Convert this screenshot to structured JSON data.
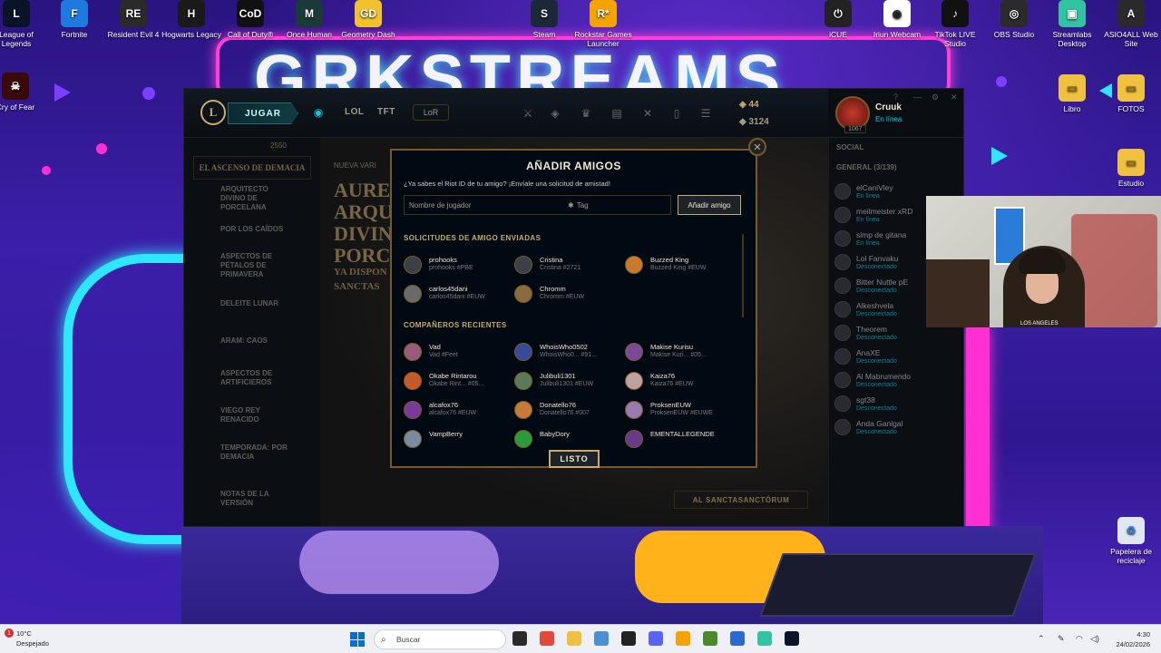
{
  "desktop": {
    "top_icons": [
      {
        "label": "League of Legends",
        "color": "#0a1428",
        "glyph": "L"
      },
      {
        "label": "Fortnite",
        "color": "#1f7ae0",
        "glyph": "F"
      },
      {
        "label": "Resident Evil 4",
        "color": "#2a2a2a",
        "glyph": "RE"
      },
      {
        "label": "Hogwarts Legacy",
        "color": "#1a1a1a",
        "glyph": "H"
      },
      {
        "label": "Call of Duty®",
        "color": "#111111",
        "glyph": "CoD"
      },
      {
        "label": "Once Human",
        "color": "#1a3a3a",
        "glyph": "M"
      },
      {
        "label": "Geometry Dash",
        "color": "#f2c12e",
        "glyph": "GD"
      },
      {
        "label": "Steam",
        "color": "#1b2838",
        "glyph": "S"
      },
      {
        "label": "Rockstar Games Launcher",
        "color": "#f4a300",
        "glyph": "R*"
      },
      {
        "label": "iCUE",
        "color": "#222222",
        "glyph": "⏻"
      },
      {
        "label": "Iriun Webcam",
        "color": "#ffffff",
        "glyph": "◉"
      },
      {
        "label": "TikTok LIVE Studio",
        "color": "#111111",
        "glyph": "♪"
      },
      {
        "label": "OBS Studio",
        "color": "#2b2b2b",
        "glyph": "◎"
      },
      {
        "label": "Streamlabs Desktop",
        "color": "#31c3a2",
        "glyph": "▣"
      },
      {
        "label": "ASIO4ALL Web Site",
        "color": "#2a2a2a",
        "glyph": "A"
      }
    ],
    "left_icon": {
      "label": "Cry of Fear",
      "color": "#3a0a0a",
      "glyph": "☠"
    },
    "right_icons": [
      {
        "label": "Libro",
        "color": "#f0c040",
        "glyph": "▭"
      },
      {
        "label": "FOTOS",
        "color": "#f0c040",
        "glyph": "▭"
      },
      {
        "label": "Estudio",
        "color": "#f0c040",
        "glyph": "▭"
      },
      {
        "label": "Papelera de reciclaje",
        "color": "#dfe8f0",
        "glyph": "♻"
      }
    ],
    "banner": "GRKSTREAMS"
  },
  "client": {
    "logo": "L",
    "play_label": "JUGAR",
    "nav": {
      "lol": "LOL",
      "tft": "TFT",
      "lor": "LoR"
    },
    "currency": {
      "blue_essence": "44",
      "rp": "3124"
    },
    "profile": {
      "name": "Cruuk",
      "status": "En línea",
      "level": "1067"
    },
    "left_panel": {
      "event_points": "2550",
      "event_title": "EL ASCENSO DE DEMACIA",
      "items": [
        "ARQUITECTO DIVINO DE PORCELANA",
        "POR LOS CAÍDOS",
        "ASPECTOS DE PÉTALOS DE PRIMAVERA",
        "DELEITE LUNAR",
        "ARAM: CAOS",
        "ASPECTOS DE ARTIFICIEROS",
        "VIEGO REY RENACIDO",
        "TEMPORADA: POR DEMACIA",
        "NOTAS DE LA VERSIÓN"
      ]
    },
    "main": {
      "kicker": "NUEVA VARI",
      "title_lines": [
        "AUREI",
        "ARQU",
        "DIVIN",
        "PORCEL"
      ],
      "subtitle_lines": [
        "YA DISPON",
        "SANCTAS"
      ],
      "cta": "AL SANCTASANCTÓRUM"
    },
    "social": {
      "header": "SOCIAL",
      "group": "GENERAL (3/139)",
      "friends": [
        {
          "name": "elCaniVley",
          "status": "En línea"
        },
        {
          "name": "meilmeister xRD",
          "status": "En línea"
        },
        {
          "name": "simp de gitana",
          "status": "En línea"
        },
        {
          "name": "Lol Fanvaku",
          "status": "Desconectado"
        },
        {
          "name": "Bitter Nuttle pE",
          "status": "Desconectado"
        },
        {
          "name": "Alkeshvela",
          "status": "Desconectado"
        },
        {
          "name": "Theorem",
          "status": "Desconectado"
        },
        {
          "name": "AnaXE",
          "status": "Desconectado"
        },
        {
          "name": "Al Mabrumendo",
          "status": "Desconectado"
        },
        {
          "name": "sgt38",
          "status": "Desconectado"
        },
        {
          "name": "Anda Ganlgal",
          "status": "Desconectado"
        }
      ]
    }
  },
  "modal": {
    "title": "AÑADIR AMIGOS",
    "subtitle": "¿Ya sabes el Riot ID de tu amigo? ¡Envíale una solicitud de amistad!",
    "input_placeholder": "Nombre de jugador",
    "tag_placeholder": "Tag",
    "add_button": "Añadir amigo",
    "sent_section": "SOLICITUDES DE AMIGO ENVIADAS",
    "sent": [
      {
        "name": "prohooks",
        "tag": "prohooks #PBE",
        "color": "#3a3f48"
      },
      {
        "name": "Cristina",
        "tag": "Cristina #2721",
        "color": "#3a3f48"
      },
      {
        "name": "Buzzed King",
        "tag": "Buzzed King #EUW",
        "color": "#c87a2a"
      },
      {
        "name": "carlos45dani",
        "tag": "carlos45dani #EUW",
        "color": "#6a6a6a"
      },
      {
        "name": "Chromm",
        "tag": "Chromm #EUW",
        "color": "#8a6a40"
      }
    ],
    "recent_section": "COMPAÑEROS RECIENTES",
    "recent": [
      {
        "name": "Vad",
        "tag": "Vad #Feet",
        "color": "#9a5a7a"
      },
      {
        "name": "WhoisWho0502",
        "tag": "WhoisWho0... #91...",
        "color": "#3a4a9a"
      },
      {
        "name": "Makise Kurisu",
        "tag": "Makise Kuri... #05...",
        "color": "#7a4a9a"
      },
      {
        "name": "Okabe Rintarou",
        "tag": "Okabe Rint... #05...",
        "color": "#c85a2a"
      },
      {
        "name": "Julibuli1301",
        "tag": "Julibuli1301 #EUW",
        "color": "#5a7a5a"
      },
      {
        "name": "Kaiza76",
        "tag": "Kaiza76 #EUW",
        "color": "#c0a0a0"
      },
      {
        "name": "alcafox76",
        "tag": "alcafox76 #EUW",
        "color": "#7a3a9a"
      },
      {
        "name": "Donatello76",
        "tag": "Donatello76 #007",
        "color": "#c87a3a"
      },
      {
        "name": "ProksenEUW",
        "tag": "ProksenEUW #EUWE",
        "color": "#9a7ab0"
      },
      {
        "name": "VampBerry",
        "tag": "",
        "color": "#7a8aa0"
      },
      {
        "name": "BabyDory",
        "tag": "",
        "color": "#2a9a3a"
      },
      {
        "name": "EMENTALLEGENDE",
        "tag": "",
        "color": "#6a3a8a"
      }
    ],
    "done_button": "LISTO",
    "close_glyph": "✕"
  },
  "webcam": {
    "caption": "LOS ANGELES"
  },
  "taskbar": {
    "weather_temp": "10°C",
    "weather_desc": "Despejado",
    "notif": "1",
    "search_placeholder": "Buscar",
    "pinned": [
      {
        "name": "file-explorer-tb",
        "color": "#2b2b2b"
      },
      {
        "name": "chrome-tb",
        "color": "#e04a3a"
      },
      {
        "name": "folder-tb",
        "color": "#f0c040"
      },
      {
        "name": "photos-tb",
        "color": "#4a90d0"
      },
      {
        "name": "epic-tb",
        "color": "#222222"
      },
      {
        "name": "discord-tb",
        "color": "#5865f2"
      },
      {
        "name": "rockstar-tb",
        "color": "#f4a300"
      },
      {
        "name": "minecraft-tb",
        "color": "#4a8a2a"
      },
      {
        "name": "browser-tb",
        "color": "#2a6ad0"
      },
      {
        "name": "streamlabs-tb",
        "color": "#31c3a2"
      },
      {
        "name": "league-tb",
        "color": "#0a1428"
      }
    ],
    "time": "4:30",
    "date": "24/02/2026"
  }
}
